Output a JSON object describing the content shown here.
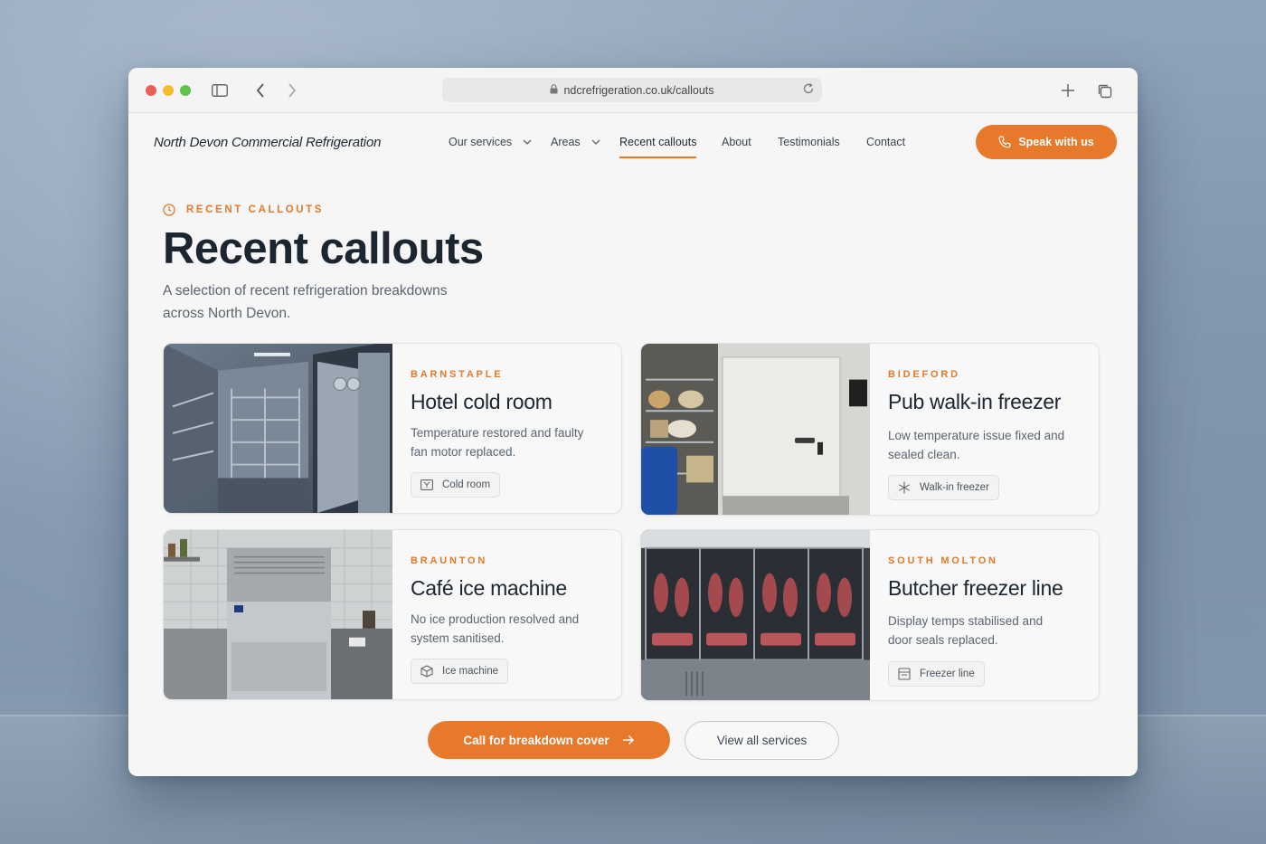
{
  "browser": {
    "url": "ndcrefrigeration.co.uk/callouts"
  },
  "nav": {
    "brand": "North Devon Commercial Refrigeration",
    "items": [
      {
        "label": "Our services",
        "has_dropdown": true
      },
      {
        "label": "Areas",
        "has_dropdown": true
      },
      {
        "label": "Recent callouts",
        "active": true
      },
      {
        "label": "About"
      },
      {
        "label": "Testimonials"
      },
      {
        "label": "Contact"
      }
    ],
    "cta_label": "Speak with us"
  },
  "hero": {
    "eyebrow": "RECENT CALLOUTS",
    "title": "Recent callouts",
    "subtitle": "A selection of recent refrigeration breakdowns across North Devon."
  },
  "callouts": [
    {
      "location": "BARNSTAPLE",
      "title": "Hotel cold room",
      "description": "Temperature restored and faulty fan motor replaced.",
      "tag": "Cold room",
      "tag_icon": "cold-room-icon"
    },
    {
      "location": "BIDEFORD",
      "title": "Pub walk-in freezer",
      "description": "Low temperature issue fixed and sealed clean.",
      "tag": "Walk-in freezer",
      "tag_icon": "snowflake-icon"
    },
    {
      "location": "BRAUNTON",
      "title": "Café ice machine",
      "description": "No ice production resolved and system sanitised.",
      "tag": "Ice machine",
      "tag_icon": "ice-cube-icon"
    },
    {
      "location": "SOUTH MOLTON",
      "title": "Butcher freezer line",
      "description": "Display temps stabilised and door seals replaced.",
      "tag": "Freezer line",
      "tag_icon": "freezer-icon"
    }
  ],
  "actions": {
    "primary": "Call for breakdown cover",
    "secondary": "View all services"
  },
  "colors": {
    "accent": "#e8782a",
    "heading": "#1b2631",
    "body": "#5b6570"
  }
}
